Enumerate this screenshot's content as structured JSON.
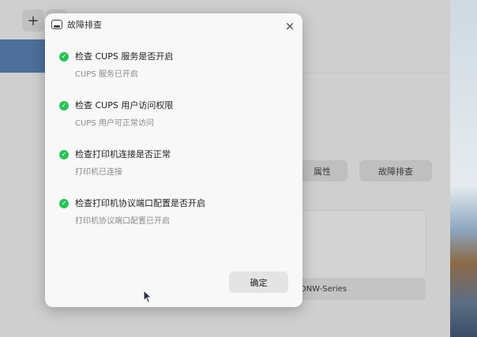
{
  "background": {
    "add_button_label": "+",
    "properties_button": "属性",
    "troubleshoot_button": "故障排查",
    "printer_model": "DNW-Series"
  },
  "dialog": {
    "title": "故障排查",
    "close_label": "×",
    "checks": [
      {
        "title": "检查 CUPS 服务是否开启",
        "status": "CUPS 服务已开启"
      },
      {
        "title": "检查 CUPS 用户访问权限",
        "status": "CUPS 用户可正常访问"
      },
      {
        "title": "检查打印机连接是否正常",
        "status": "打印机已连接"
      },
      {
        "title": "检查打印机协议端口配置是否开启",
        "status": "打印机协议端口配置已开启"
      }
    ],
    "ok_button": "确定"
  },
  "colors": {
    "check_green": "#2ec05a",
    "selection_blue": "#4d6f9a"
  },
  "icons": {
    "app": "printer-app-icon",
    "check": "check-circle-icon",
    "close": "close-icon"
  }
}
